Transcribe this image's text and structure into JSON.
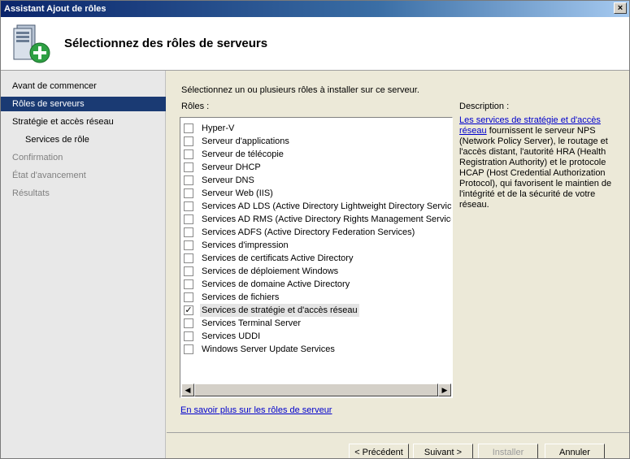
{
  "window": {
    "title": "Assistant Ajout de rôles",
    "close_label": "×"
  },
  "header": {
    "title": "Sélectionnez des rôles de serveurs",
    "icon": "server-roles-add-icon"
  },
  "nav": {
    "items": [
      {
        "label": "Avant de commencer"
      },
      {
        "label": "Rôles de serveurs"
      },
      {
        "label": "Stratégie et accès réseau"
      },
      {
        "label": "Services de rôle"
      },
      {
        "label": "Confirmation"
      },
      {
        "label": "État d'avancement"
      },
      {
        "label": "Résultats"
      }
    ]
  },
  "main": {
    "instruction": "Sélectionnez un ou plusieurs rôles à installer sur ce serveur.",
    "roles_label": "Rôles :",
    "roles": [
      {
        "label": "Hyper-V",
        "checked": false
      },
      {
        "label": "Serveur d'applications",
        "checked": false
      },
      {
        "label": "Serveur de télécopie",
        "checked": false
      },
      {
        "label": "Serveur DHCP",
        "checked": false
      },
      {
        "label": "Serveur DNS",
        "checked": false
      },
      {
        "label": "Serveur Web (IIS)",
        "checked": false
      },
      {
        "label": "Services AD LDS (Active Directory Lightweight Directory Services)",
        "checked": false
      },
      {
        "label": "Services AD RMS (Active Directory Rights Management Services)",
        "checked": false
      },
      {
        "label": "Services ADFS (Active Directory Federation Services)",
        "checked": false
      },
      {
        "label": "Services d'impression",
        "checked": false
      },
      {
        "label": "Services de certificats Active Directory",
        "checked": false
      },
      {
        "label": "Services de déploiement Windows",
        "checked": false
      },
      {
        "label": "Services de domaine Active Directory",
        "checked": false
      },
      {
        "label": "Services de fichiers",
        "checked": false
      },
      {
        "label": "Services de stratégie et d'accès réseau",
        "checked": true
      },
      {
        "label": "Services Terminal Server",
        "checked": false
      },
      {
        "label": "Services UDDI",
        "checked": false
      },
      {
        "label": "Windows Server Update Services",
        "checked": false
      }
    ],
    "description_label": "Description :",
    "description_link": "Les services de stratégie et d'accès réseau",
    "description_text": " fournissent le serveur NPS (Network Policy Server), le routage et l'accès distant, l'autorité HRA (Health Registration Authority) et le protocole HCAP (Host Credential Authorization Protocol), qui favorisent le maintien de l'intégrité et de la sécurité de votre réseau.",
    "learn_more": "En savoir plus sur les rôles de serveur"
  },
  "footer": {
    "prev": "< Précédent",
    "next": "Suivant >",
    "install": "Installer",
    "cancel": "Annuler"
  }
}
